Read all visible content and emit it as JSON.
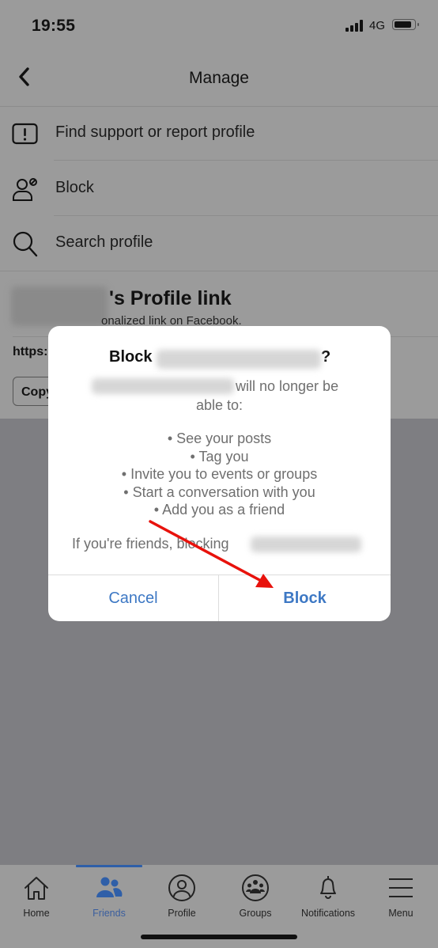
{
  "status_bar": {
    "time": "19:55",
    "network": "4G",
    "icons": [
      "signal-icon",
      "battery-icon"
    ]
  },
  "header": {
    "title": "Manage",
    "back_icon": "chevron-left-icon"
  },
  "menu": {
    "items": [
      {
        "label": "Find support or report profile",
        "icon": "report-icon"
      },
      {
        "label": "Block",
        "icon": "block-user-icon"
      },
      {
        "label": "Search profile",
        "icon": "search-icon"
      }
    ]
  },
  "profile_link": {
    "title_suffix": "'s Profile link",
    "subtitle_visible": "onalized link on Facebook.",
    "url_prefix": "https:",
    "copy_label": "Copy"
  },
  "dialog": {
    "title_prefix": "Block",
    "title_suffix": "?",
    "line1_suffix": "will no longer be",
    "line2": "able to:",
    "bullets": [
      "• See your posts",
      "• Tag you",
      "• Invite you to events or groups",
      "• Start a conversation with you",
      "• Add you as a friend"
    ],
    "friends_note": "If you're friends, blocking",
    "cancel_label": "Cancel",
    "block_label": "Block",
    "button_color": "#3d78c4"
  },
  "annotation": {
    "type": "red-arrow",
    "points_to": "Block button",
    "color": "#e8120c"
  },
  "tabbar": {
    "active": "Friends",
    "accent": "#2f5fa8",
    "tabs": [
      {
        "label": "Home",
        "icon": "home-icon"
      },
      {
        "label": "Friends",
        "icon": "friends-icon"
      },
      {
        "label": "Profile",
        "icon": "profile-icon"
      },
      {
        "label": "Groups",
        "icon": "groups-icon"
      },
      {
        "label": "Notifications",
        "icon": "bell-icon"
      },
      {
        "label": "Menu",
        "icon": "menu-icon"
      }
    ]
  }
}
